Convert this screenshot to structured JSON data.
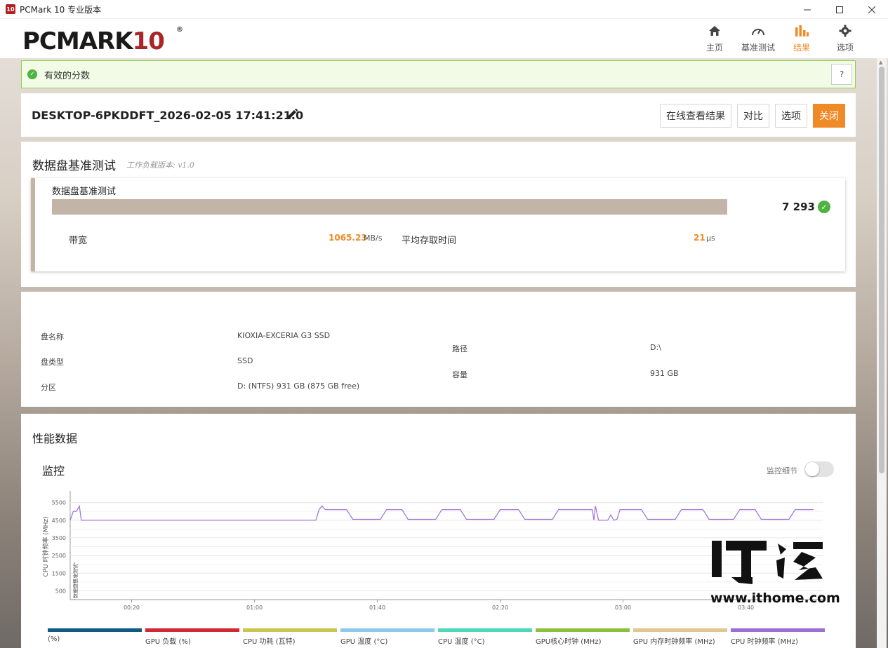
{
  "window": {
    "title": "PCMark 10 专业版本",
    "app_icon_text": "10"
  },
  "header": {
    "logo_main": "PCMARK",
    "logo_num": "10",
    "logo_reg": "®",
    "nav": [
      {
        "label": "主页",
        "icon": "home-icon",
        "active": false
      },
      {
        "label": "基准测试",
        "icon": "gauge-icon",
        "active": false
      },
      {
        "label": "结果",
        "icon": "bar-chart-icon",
        "active": true
      },
      {
        "label": "选项",
        "icon": "gear-icon",
        "active": false
      }
    ]
  },
  "banner": {
    "text": "有效的分数",
    "help": "?"
  },
  "result": {
    "title": "DESKTOP-6PKDDFT_2026-02-05 17:41:21.0",
    "buttons": {
      "online": "在线查看结果",
      "compare": "对比",
      "options": "选项",
      "close": "关闭"
    }
  },
  "benchmark": {
    "title": "数据盘基准测试",
    "version": "工作负载版本: v1.0",
    "sub_title": "数据盘基准测试",
    "score": "7 293",
    "bandwidth_label": "带宽",
    "bandwidth_value": "1065.23",
    "bandwidth_unit": "MB/s",
    "access_label": "平均存取时间",
    "access_value": "21",
    "access_unit": "μs"
  },
  "drive": {
    "name_label": "盘名称",
    "name_value": "KIOXIA-EXCERIA G3 SSD",
    "type_label": "盘类型",
    "type_value": "SSD",
    "partition_label": "分区",
    "partition_value": "D: (NTFS) 931 GB (875 GB free)",
    "path_label": "路径",
    "path_value": "D:\\",
    "capacity_label": "容量",
    "capacity_value": "931 GB"
  },
  "performance": {
    "title": "性能数据",
    "monitor_title": "监控",
    "toggle_label": "监控细节",
    "toggle_on": false
  },
  "chart_data": {
    "type": "line",
    "ylabel": "CPU 时钟频率 (MHz)",
    "annotation": "数据盘基准测试",
    "yticks": [
      500,
      1500,
      2500,
      3500,
      4500,
      5500
    ],
    "ylim": [
      0,
      6000
    ],
    "xticks": [
      "00:20",
      "01:00",
      "01:40",
      "02:20",
      "03:00",
      "03:40"
    ],
    "xlim_seconds": [
      0,
      245
    ],
    "xtick_seconds": [
      20,
      60,
      100,
      140,
      180,
      220
    ],
    "series": [
      {
        "name": "CPU 时钟频率 (MHz)",
        "color": "#9b6fd6",
        "points": [
          [
            0,
            4500
          ],
          [
            1,
            5000
          ],
          [
            2,
            5000
          ],
          [
            3,
            5300
          ],
          [
            3.6,
            4500
          ],
          [
            80,
            4500
          ],
          [
            81,
            5100
          ],
          [
            82,
            5300
          ],
          [
            83,
            5100
          ],
          [
            90,
            5100
          ],
          [
            92,
            4550
          ],
          [
            101,
            4550
          ],
          [
            103,
            5100
          ],
          [
            108,
            5100
          ],
          [
            110,
            4550
          ],
          [
            119,
            4550
          ],
          [
            121,
            5100
          ],
          [
            127,
            5100
          ],
          [
            129,
            4550
          ],
          [
            138,
            4550
          ],
          [
            140,
            5100
          ],
          [
            146,
            5100
          ],
          [
            148,
            4550
          ],
          [
            157,
            4550
          ],
          [
            159,
            5100
          ],
          [
            170,
            5100
          ],
          [
            170.5,
            4500
          ],
          [
            171,
            5300
          ],
          [
            172,
            4500
          ],
          [
            175,
            4500
          ],
          [
            176,
            4800
          ],
          [
            177,
            4500
          ],
          [
            178,
            4550
          ],
          [
            179,
            5100
          ],
          [
            186,
            5100
          ],
          [
            188,
            4550
          ],
          [
            197,
            4550
          ],
          [
            199,
            5100
          ],
          [
            206,
            5100
          ],
          [
            208,
            4550
          ],
          [
            216,
            4550
          ],
          [
            218,
            5100
          ],
          [
            223,
            5100
          ],
          [
            225,
            4550
          ],
          [
            234,
            4550
          ],
          [
            236,
            5100
          ],
          [
            242,
            5100
          ]
        ]
      }
    ]
  },
  "legend": [
    {
      "label": "(%)",
      "color": "#0d5b85"
    },
    {
      "label": "GPU 负载 (%)",
      "color": "#cf2a34"
    },
    {
      "label": "CPU 功耗 (瓦特)",
      "color": "#c8c64c"
    },
    {
      "label": "GPU 温度 (°C)",
      "color": "#8ec8ea"
    },
    {
      "label": "CPU 温度 (°C)",
      "color": "#4fd8b6"
    },
    {
      "label": "GPU核心时钟 (MHz)",
      "color": "#8cbf3b"
    },
    {
      "label": "GPU 内存时钟频率 (MHz)",
      "color": "#e2c690"
    },
    {
      "label": "CPU 时钟频率 (MHz)",
      "color": "#9b6fd6"
    }
  ],
  "watermark": {
    "logo": "IT之家",
    "url": "www.ithome.com"
  }
}
